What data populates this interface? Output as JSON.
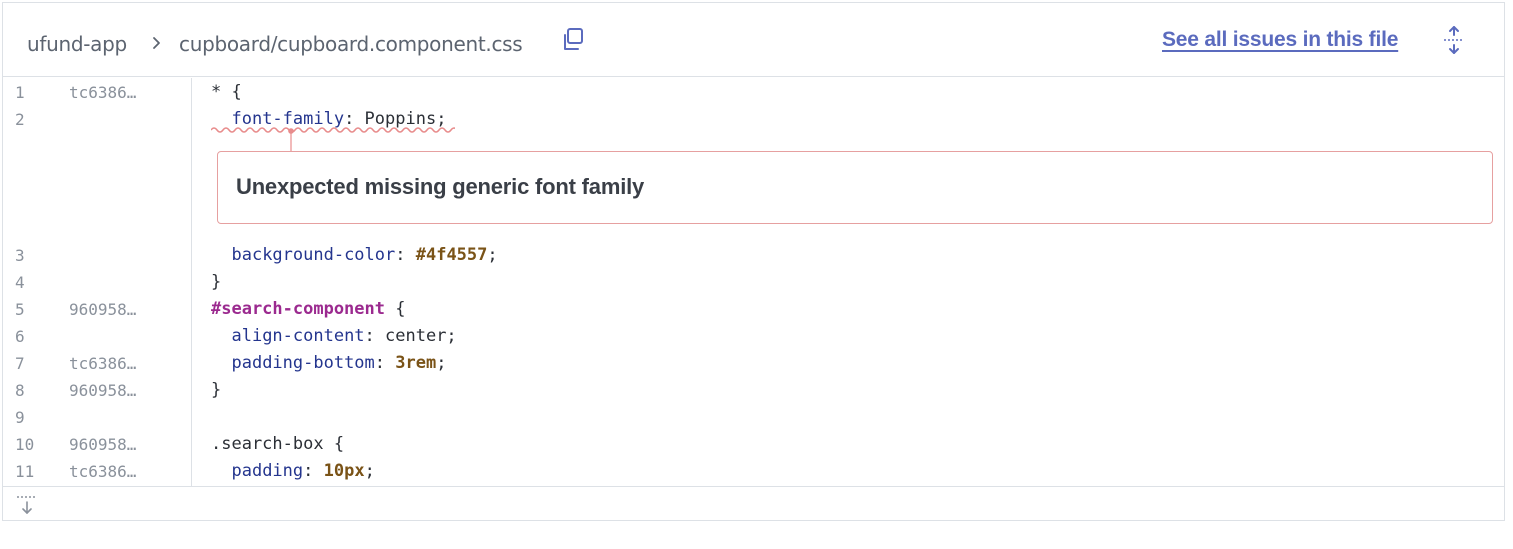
{
  "header": {
    "project": "ufund-app",
    "file_path": "cupboard/cupboard.component.css",
    "see_all_label": "See all issues in this file",
    "icons": {
      "separator": "chevron-right-icon",
      "copy": "copy-icon",
      "expand": "expand-icon"
    }
  },
  "colors": {
    "link": "#5b6bbe",
    "property": "#24358e",
    "number": "#7a5317",
    "selector_id": "#9b2a8f",
    "issue_border": "#e6a0a0",
    "squiggle": "#e88c8c"
  },
  "issue": {
    "message": "Unexpected missing generic font family"
  },
  "lines": [
    {
      "number": "1",
      "author": "tc6386…",
      "tokens": [
        {
          "t": "punc",
          "v": "* {"
        }
      ]
    },
    {
      "number": "2",
      "author": "",
      "tokens": [
        {
          "t": "punc",
          "v": "  "
        },
        {
          "t": "prop",
          "v": "font-family"
        },
        {
          "t": "punc",
          "v": ": Poppins;"
        }
      ]
    },
    {
      "number": "3",
      "author": "",
      "tokens": [
        {
          "t": "punc",
          "v": "  "
        },
        {
          "t": "prop",
          "v": "background-color"
        },
        {
          "t": "punc",
          "v": ": "
        },
        {
          "t": "num",
          "v": "#4f4557"
        },
        {
          "t": "punc",
          "v": ";"
        }
      ]
    },
    {
      "number": "4",
      "author": "",
      "tokens": [
        {
          "t": "punc",
          "v": "}"
        }
      ]
    },
    {
      "number": "5",
      "author": "960958…",
      "tokens": [
        {
          "t": "id",
          "v": "#search-component"
        },
        {
          "t": "punc",
          "v": " {"
        }
      ]
    },
    {
      "number": "6",
      "author": "",
      "tokens": [
        {
          "t": "punc",
          "v": "  "
        },
        {
          "t": "prop",
          "v": "align-content"
        },
        {
          "t": "punc",
          "v": ": center;"
        }
      ]
    },
    {
      "number": "7",
      "author": "tc6386…",
      "tokens": [
        {
          "t": "punc",
          "v": "  "
        },
        {
          "t": "prop",
          "v": "padding-bottom"
        },
        {
          "t": "punc",
          "v": ": "
        },
        {
          "t": "num",
          "v": "3rem"
        },
        {
          "t": "punc",
          "v": ";"
        }
      ]
    },
    {
      "number": "8",
      "author": "960958…",
      "tokens": [
        {
          "t": "punc",
          "v": "}"
        }
      ]
    },
    {
      "number": "9",
      "author": "",
      "tokens": []
    },
    {
      "number": "10",
      "author": "960958…",
      "tokens": [
        {
          "t": "punc",
          "v": ".search-box {"
        }
      ]
    },
    {
      "number": "11",
      "author": "tc6386…",
      "tokens": [
        {
          "t": "punc",
          "v": "  "
        },
        {
          "t": "prop",
          "v": "padding"
        },
        {
          "t": "punc",
          "v": ": "
        },
        {
          "t": "num",
          "v": "10px"
        },
        {
          "t": "punc",
          "v": ";"
        }
      ]
    }
  ],
  "footer": {
    "load_more_icon": "load-more-icon"
  }
}
